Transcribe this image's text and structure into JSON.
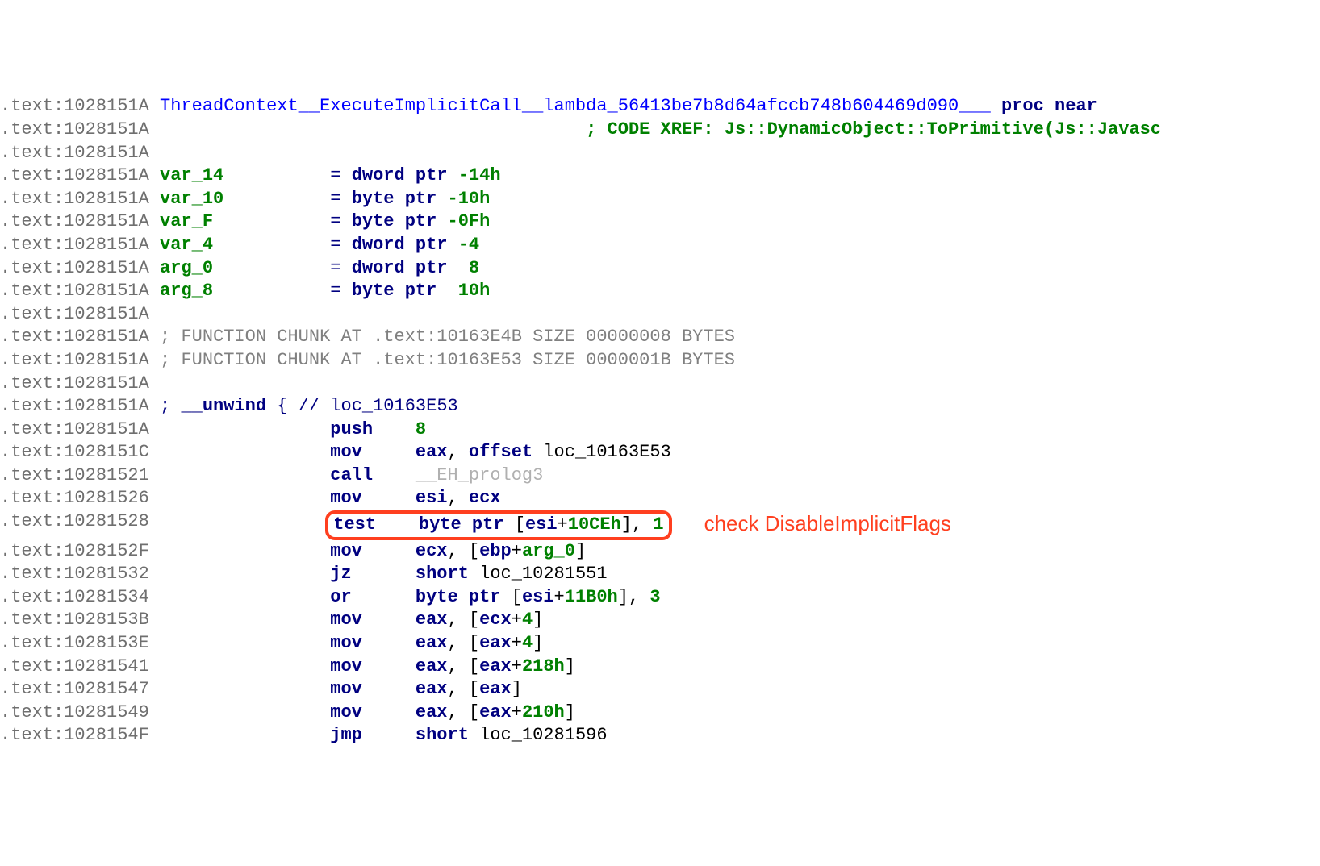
{
  "lines": [
    {
      "addr": ".text:1028151A",
      "parts": [
        {
          "t": " ",
          "c": "black"
        },
        {
          "t": "ThreadContext__ExecuteImplicitCall__lambda_56413be7b8d64afccb748b604469d090___",
          "c": "proc-name"
        },
        {
          "t": " ",
          "c": "black"
        },
        {
          "t": "proc",
          "c": "keyword"
        },
        {
          "t": " ",
          "c": "black"
        },
        {
          "t": "near",
          "c": "keyword"
        }
      ]
    },
    {
      "addr": ".text:1028151A",
      "parts": [
        {
          "t": "                                         ",
          "c": "black"
        },
        {
          "t": "; CODE XREF: Js::DynamicObject::ToPrimitive(Js::Javasc",
          "c": "green-cmt"
        }
      ]
    },
    {
      "addr": ".text:1028151A",
      "parts": []
    },
    {
      "addr": ".text:1028151A",
      "parts": [
        {
          "t": " ",
          "c": "black"
        },
        {
          "t": "var_14",
          "c": "varname"
        },
        {
          "t": "          ",
          "c": "black"
        },
        {
          "t": "=",
          "c": "keyword-nf"
        },
        {
          "t": " ",
          "c": "black"
        },
        {
          "t": "dword ptr",
          "c": "keyword"
        },
        {
          "t": " ",
          "c": "black"
        },
        {
          "t": "-14h",
          "c": "number"
        }
      ]
    },
    {
      "addr": ".text:1028151A",
      "parts": [
        {
          "t": " ",
          "c": "black"
        },
        {
          "t": "var_10",
          "c": "varname"
        },
        {
          "t": "          ",
          "c": "black"
        },
        {
          "t": "=",
          "c": "keyword-nf"
        },
        {
          "t": " ",
          "c": "black"
        },
        {
          "t": "byte ptr",
          "c": "keyword"
        },
        {
          "t": " ",
          "c": "black"
        },
        {
          "t": "-10h",
          "c": "number"
        }
      ]
    },
    {
      "addr": ".text:1028151A",
      "parts": [
        {
          "t": " ",
          "c": "black"
        },
        {
          "t": "var_F",
          "c": "varname"
        },
        {
          "t": "           ",
          "c": "black"
        },
        {
          "t": "=",
          "c": "keyword-nf"
        },
        {
          "t": " ",
          "c": "black"
        },
        {
          "t": "byte ptr",
          "c": "keyword"
        },
        {
          "t": " ",
          "c": "black"
        },
        {
          "t": "-0Fh",
          "c": "number"
        }
      ]
    },
    {
      "addr": ".text:1028151A",
      "parts": [
        {
          "t": " ",
          "c": "black"
        },
        {
          "t": "var_4",
          "c": "varname"
        },
        {
          "t": "           ",
          "c": "black"
        },
        {
          "t": "=",
          "c": "keyword-nf"
        },
        {
          "t": " ",
          "c": "black"
        },
        {
          "t": "dword ptr",
          "c": "keyword"
        },
        {
          "t": " ",
          "c": "black"
        },
        {
          "t": "-4",
          "c": "number"
        }
      ]
    },
    {
      "addr": ".text:1028151A",
      "parts": [
        {
          "t": " ",
          "c": "black"
        },
        {
          "t": "arg_0",
          "c": "varname"
        },
        {
          "t": "           ",
          "c": "black"
        },
        {
          "t": "=",
          "c": "keyword-nf"
        },
        {
          "t": " ",
          "c": "black"
        },
        {
          "t": "dword ptr",
          "c": "keyword"
        },
        {
          "t": "  ",
          "c": "black"
        },
        {
          "t": "8",
          "c": "number"
        }
      ]
    },
    {
      "addr": ".text:1028151A",
      "parts": [
        {
          "t": " ",
          "c": "black"
        },
        {
          "t": "arg_8",
          "c": "varname"
        },
        {
          "t": "           ",
          "c": "black"
        },
        {
          "t": "=",
          "c": "keyword-nf"
        },
        {
          "t": " ",
          "c": "black"
        },
        {
          "t": "byte ptr",
          "c": "keyword"
        },
        {
          "t": "  ",
          "c": "black"
        },
        {
          "t": "10h",
          "c": "number"
        }
      ]
    },
    {
      "addr": ".text:1028151A",
      "parts": []
    },
    {
      "addr": ".text:1028151A",
      "parts": [
        {
          "t": " ",
          "c": "black"
        },
        {
          "t": ";",
          "c": "comment"
        },
        {
          "t": " FUNCTION CHUNK AT ",
          "c": "comment"
        },
        {
          "t": ".text:10163E4B",
          "c": "comment"
        },
        {
          "t": " SIZE 00000008 BYTES",
          "c": "comment"
        }
      ]
    },
    {
      "addr": ".text:1028151A",
      "parts": [
        {
          "t": " ",
          "c": "black"
        },
        {
          "t": ";",
          "c": "comment"
        },
        {
          "t": " FUNCTION CHUNK AT ",
          "c": "comment"
        },
        {
          "t": ".text:10163E53",
          "c": "comment"
        },
        {
          "t": " SIZE 0000001B BYTES",
          "c": "comment"
        }
      ]
    },
    {
      "addr": ".text:1028151A",
      "parts": []
    },
    {
      "addr": ".text:1028151A",
      "parts": [
        {
          "t": " ",
          "c": "black"
        },
        {
          "t": ";",
          "c": "keyword-nf"
        },
        {
          "t": " ",
          "c": "black"
        },
        {
          "t": "__unwind",
          "c": "keyword"
        },
        {
          "t": " { ",
          "c": "keyword-nf"
        },
        {
          "t": "//",
          "c": "keyword-nf"
        },
        {
          "t": " loc_10163E53",
          "c": "keyword-nf"
        }
      ]
    },
    {
      "addr": ".text:1028151A",
      "parts": [
        {
          "t": "                 ",
          "c": "black"
        },
        {
          "t": "push",
          "c": "keyword"
        },
        {
          "t": "    ",
          "c": "black"
        },
        {
          "t": "8",
          "c": "number"
        }
      ]
    },
    {
      "addr": ".text:1028151C",
      "parts": [
        {
          "t": "                 ",
          "c": "black"
        },
        {
          "t": "mov",
          "c": "keyword"
        },
        {
          "t": "     ",
          "c": "black"
        },
        {
          "t": "eax",
          "c": "keyword"
        },
        {
          "t": ", ",
          "c": "black"
        },
        {
          "t": "offset",
          "c": "keyword"
        },
        {
          "t": " loc_10163E53",
          "c": "label"
        }
      ]
    },
    {
      "addr": ".text:10281521",
      "parts": [
        {
          "t": "                 ",
          "c": "black"
        },
        {
          "t": "call",
          "c": "keyword"
        },
        {
          "t": "    ",
          "c": "black"
        },
        {
          "t": "__EH_prolog3",
          "c": "faded"
        }
      ]
    },
    {
      "addr": ".text:10281526",
      "parts": [
        {
          "t": "                 ",
          "c": "black"
        },
        {
          "t": "mov",
          "c": "keyword"
        },
        {
          "t": "     ",
          "c": "black"
        },
        {
          "t": "esi",
          "c": "keyword"
        },
        {
          "t": ", ",
          "c": "black"
        },
        {
          "t": "ecx",
          "c": "keyword"
        }
      ]
    },
    {
      "addr": ".text:10281528",
      "box": true,
      "annotation": "check DisableImplicitFlags",
      "parts": [
        {
          "t": "                 ",
          "c": "black"
        },
        {
          "t": "test",
          "c": "keyword"
        },
        {
          "t": "    ",
          "c": "black"
        },
        {
          "t": "byte ptr",
          "c": "keyword"
        },
        {
          "t": " [",
          "c": "black"
        },
        {
          "t": "esi",
          "c": "keyword"
        },
        {
          "t": "+",
          "c": "black"
        },
        {
          "t": "10CEh",
          "c": "number"
        },
        {
          "t": "], ",
          "c": "black"
        },
        {
          "t": "1",
          "c": "number"
        }
      ]
    },
    {
      "addr": ".text:1028152F",
      "parts": [
        {
          "t": "                 ",
          "c": "black"
        },
        {
          "t": "mov",
          "c": "keyword"
        },
        {
          "t": "     ",
          "c": "black"
        },
        {
          "t": "ecx",
          "c": "keyword"
        },
        {
          "t": ", [",
          "c": "black"
        },
        {
          "t": "ebp",
          "c": "keyword"
        },
        {
          "t": "+",
          "c": "black"
        },
        {
          "t": "arg_0",
          "c": "varname"
        },
        {
          "t": "]",
          "c": "black"
        }
      ]
    },
    {
      "addr": ".text:10281532",
      "parts": [
        {
          "t": "                 ",
          "c": "black"
        },
        {
          "t": "jz",
          "c": "keyword"
        },
        {
          "t": "      ",
          "c": "black"
        },
        {
          "t": "short",
          "c": "keyword"
        },
        {
          "t": " loc_10281551",
          "c": "label"
        }
      ]
    },
    {
      "addr": ".text:10281534",
      "parts": [
        {
          "t": "                 ",
          "c": "black"
        },
        {
          "t": "or",
          "c": "keyword"
        },
        {
          "t": "      ",
          "c": "black"
        },
        {
          "t": "byte ptr",
          "c": "keyword"
        },
        {
          "t": " [",
          "c": "black"
        },
        {
          "t": "esi",
          "c": "keyword"
        },
        {
          "t": "+",
          "c": "black"
        },
        {
          "t": "11B0h",
          "c": "number"
        },
        {
          "t": "], ",
          "c": "black"
        },
        {
          "t": "3",
          "c": "number"
        }
      ]
    },
    {
      "addr": ".text:1028153B",
      "parts": [
        {
          "t": "                 ",
          "c": "black"
        },
        {
          "t": "mov",
          "c": "keyword"
        },
        {
          "t": "     ",
          "c": "black"
        },
        {
          "t": "eax",
          "c": "keyword"
        },
        {
          "t": ", [",
          "c": "black"
        },
        {
          "t": "ecx",
          "c": "keyword"
        },
        {
          "t": "+",
          "c": "black"
        },
        {
          "t": "4",
          "c": "number"
        },
        {
          "t": "]",
          "c": "black"
        }
      ]
    },
    {
      "addr": ".text:1028153E",
      "parts": [
        {
          "t": "                 ",
          "c": "black"
        },
        {
          "t": "mov",
          "c": "keyword"
        },
        {
          "t": "     ",
          "c": "black"
        },
        {
          "t": "eax",
          "c": "keyword"
        },
        {
          "t": ", [",
          "c": "black"
        },
        {
          "t": "eax",
          "c": "keyword"
        },
        {
          "t": "+",
          "c": "black"
        },
        {
          "t": "4",
          "c": "number"
        },
        {
          "t": "]",
          "c": "black"
        }
      ]
    },
    {
      "addr": ".text:10281541",
      "parts": [
        {
          "t": "                 ",
          "c": "black"
        },
        {
          "t": "mov",
          "c": "keyword"
        },
        {
          "t": "     ",
          "c": "black"
        },
        {
          "t": "eax",
          "c": "keyword"
        },
        {
          "t": ", [",
          "c": "black"
        },
        {
          "t": "eax",
          "c": "keyword"
        },
        {
          "t": "+",
          "c": "black"
        },
        {
          "t": "218h",
          "c": "number"
        },
        {
          "t": "]",
          "c": "black"
        }
      ]
    },
    {
      "addr": ".text:10281547",
      "parts": [
        {
          "t": "                 ",
          "c": "black"
        },
        {
          "t": "mov",
          "c": "keyword"
        },
        {
          "t": "     ",
          "c": "black"
        },
        {
          "t": "eax",
          "c": "keyword"
        },
        {
          "t": ", [",
          "c": "black"
        },
        {
          "t": "eax",
          "c": "keyword"
        },
        {
          "t": "]",
          "c": "black"
        }
      ]
    },
    {
      "addr": ".text:10281549",
      "parts": [
        {
          "t": "                 ",
          "c": "black"
        },
        {
          "t": "mov",
          "c": "keyword"
        },
        {
          "t": "     ",
          "c": "black"
        },
        {
          "t": "eax",
          "c": "keyword"
        },
        {
          "t": ", [",
          "c": "black"
        },
        {
          "t": "eax",
          "c": "keyword"
        },
        {
          "t": "+",
          "c": "black"
        },
        {
          "t": "210h",
          "c": "number"
        },
        {
          "t": "]",
          "c": "black"
        }
      ]
    },
    {
      "addr": ".text:1028154F",
      "parts": [
        {
          "t": "                 ",
          "c": "black"
        },
        {
          "t": "jmp",
          "c": "keyword"
        },
        {
          "t": "     ",
          "c": "black"
        },
        {
          "t": "short",
          "c": "keyword"
        },
        {
          "t": " loc_10281596",
          "c": "label"
        }
      ]
    }
  ]
}
